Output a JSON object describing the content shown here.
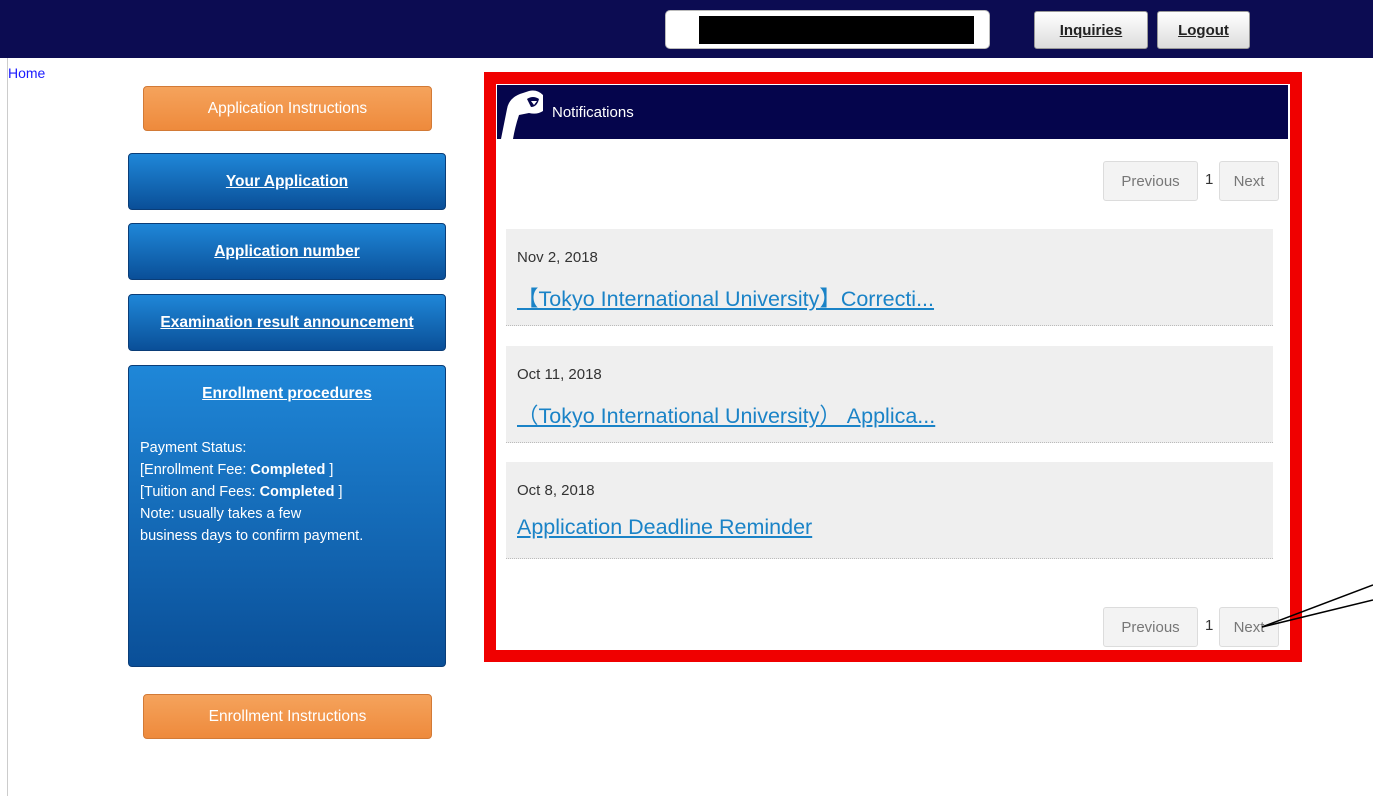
{
  "header": {
    "inquiries_label": "Inquiries",
    "logout_label": "Logout",
    "user_name_redacted": true
  },
  "breadcrumb": {
    "home_label": "Home"
  },
  "sidebar": {
    "application_instructions_label": "Application Instructions",
    "your_application_label": "Your Application",
    "application_number_label": "Application number",
    "exam_result_label": "Examination result announcement",
    "enrollment": {
      "title": "Enrollment procedures",
      "payment_status_label": "Payment Status:",
      "enrollment_fee_label": "[Enrollment Fee:",
      "enrollment_fee_status": "Completed",
      "tuition_label": "[Tuition and Fees:",
      "tuition_status": "Completed",
      "close_bracket": "]",
      "note_line1": "Note: usually takes a few",
      "note_line2": "business days to confirm payment."
    },
    "enrollment_instructions_label": "Enrollment Instructions"
  },
  "notifications": {
    "title": "Notifications",
    "pager": {
      "previous_label": "Previous",
      "page": "1",
      "next_label": "Next"
    },
    "items": [
      {
        "date": "Nov 2, 2018",
        "title": "【Tokyo International University】Correcti..."
      },
      {
        "date": "Oct 11, 2018",
        "title": "（Tokyo International University） Applica..."
      },
      {
        "date": "Oct 8, 2018",
        "title": "Application Deadline Reminder"
      }
    ]
  },
  "colors": {
    "topbar": "#0c0c52",
    "header_bar": "#05054c",
    "orange_button": "#ee8a3c",
    "blue_button": "#0a4f98",
    "highlight_frame": "#f00000",
    "link": "#1a83c7"
  },
  "icons": {
    "notifications_icon": "megaphone-icon"
  }
}
